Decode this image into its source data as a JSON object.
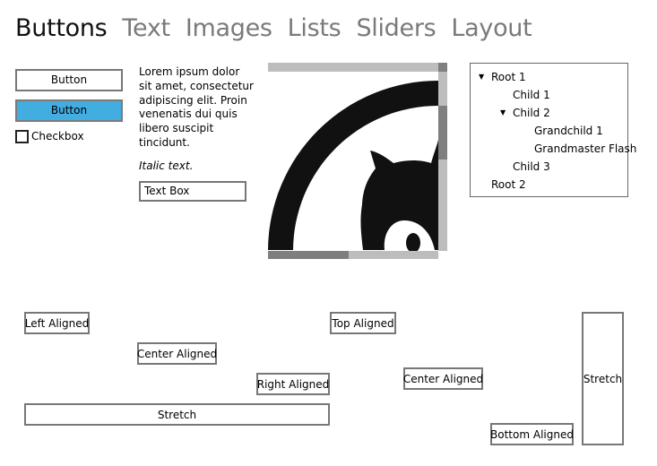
{
  "tabs": [
    {
      "label": "Buttons",
      "active": true
    },
    {
      "label": "Text",
      "active": false
    },
    {
      "label": "Images",
      "active": false
    },
    {
      "label": "Lists",
      "active": false
    },
    {
      "label": "Sliders",
      "active": false
    },
    {
      "label": "Layout",
      "active": false
    }
  ],
  "buttons": {
    "button1_label": "Button",
    "button2_label": "Button",
    "checkbox_label": "Checkbox",
    "checkbox_checked": false,
    "accent_color": "#41ade1"
  },
  "text": {
    "paragraph": "Lorem ipsum dolor sit amet, consectetur adipiscing elit. Proin venenatis dui quis libero suscipit tincidunt.",
    "italic": "Italic text.",
    "textbox_value": "Text Box"
  },
  "image": {
    "icon": "github-octocat-icon"
  },
  "tree": {
    "items": [
      {
        "label": "Root 1",
        "expanded": true
      },
      {
        "label": "Child 1"
      },
      {
        "label": "Child 2",
        "expanded": true
      },
      {
        "label": "Grandchild 1"
      },
      {
        "label": "Grandmaster Flash"
      },
      {
        "label": "Child 3"
      },
      {
        "label": "Root 2"
      }
    ]
  },
  "layout": {
    "left_aligned": "Left Aligned",
    "center_aligned": "Center Aligned",
    "right_aligned": "Right Aligned",
    "stretch_h": "Stretch",
    "top_aligned": "Top Aligned",
    "center_aligned_v": "Center Aligned",
    "bottom_aligned": "Bottom Aligned",
    "stretch_v": "Stretch"
  }
}
